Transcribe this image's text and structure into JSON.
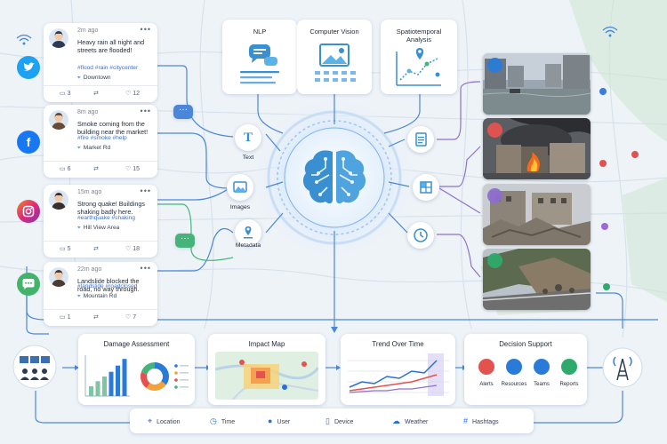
{
  "posts": [
    {
      "time": "2m ago",
      "text": "Heavy rain all night and streets are flooded!",
      "tags": "#flood  #rain  #citycenter",
      "location": "Downtown",
      "replies": "3",
      "likes": "12",
      "avatar_color": "#2b3a55"
    },
    {
      "time": "8m ago",
      "text": "Smoke coming from the building near the market!",
      "tags": "#fire  #smoke  #help",
      "location": "Market Rd",
      "replies": "6",
      "likes": "15",
      "avatar_color": "#6b4a35"
    },
    {
      "time": "15m ago",
      "text": "Strong quake! Buildings shaking badly here.",
      "tags": "#earthquake  #shaking",
      "location": "Hill View Area",
      "replies": "5",
      "likes": "18",
      "avatar_color": "#3a2e2a"
    },
    {
      "time": "22m ago",
      "text": "Landslide blocked the road, no way through.",
      "tags": "#landslide  #roadclosed",
      "location": "Mountain Rd",
      "replies": "1",
      "likes": "7",
      "avatar_color": "#4a3a30"
    }
  ],
  "social_icons": [
    "twitter-icon",
    "facebook-icon",
    "instagram-icon",
    "message-icon"
  ],
  "modules": [
    {
      "label": "NLP"
    },
    {
      "label": "Computer Vision"
    },
    {
      "label": "Spatiotemporal Analysis"
    }
  ],
  "inputs": [
    {
      "label": "Text",
      "icon": "text-icon"
    },
    {
      "label": "Images",
      "icon": "image-icon"
    },
    {
      "label": "Metadata",
      "icon": "metadata-icon"
    }
  ],
  "outputs": [
    {
      "icon": "document-icon"
    },
    {
      "icon": "map-grid-icon"
    },
    {
      "icon": "clock-icon"
    }
  ],
  "photos": [
    {
      "icon": "flood-icon"
    },
    {
      "icon": "fire-icon"
    },
    {
      "icon": "collapsed-house-icon"
    },
    {
      "icon": "landslide-icon"
    }
  ],
  "panels": {
    "damage": {
      "title": "Damage Assessment",
      "bars": [
        0.25,
        0.38,
        0.5,
        0.62,
        0.78,
        0.95
      ],
      "donut": [
        0.35,
        0.25,
        0.2,
        0.2
      ]
    },
    "impact": {
      "title": "Impact Map"
    },
    "trend": {
      "title": "Trend Over Time"
    },
    "decision": {
      "title": "Decision Support",
      "items": [
        {
          "label": "Alerts",
          "icon": "alert-bell-icon",
          "color": "#e4524f"
        },
        {
          "label": "Resources",
          "icon": "truck-icon",
          "color": "#2a7bd8"
        },
        {
          "label": "Teams",
          "icon": "team-icon",
          "color": "#2a7bd8"
        },
        {
          "label": "Reports",
          "icon": "report-icon",
          "color": "#2faa6b"
        }
      ]
    }
  },
  "legend": [
    {
      "label": "Location",
      "icon": "location-pin-icon",
      "glyph": "⌖"
    },
    {
      "label": "Time",
      "icon": "clock-icon",
      "glyph": "◷"
    },
    {
      "label": "User",
      "icon": "user-icon",
      "glyph": "●"
    },
    {
      "label": "Device",
      "icon": "device-icon",
      "glyph": "▯"
    },
    {
      "label": "Weather",
      "icon": "cloud-icon",
      "glyph": "☁"
    },
    {
      "label": "Hashtags",
      "icon": "hashtag-icon",
      "glyph": "#"
    }
  ],
  "colors": {
    "accent": "#2a6fd8",
    "line": "#4a87d8",
    "brain": "#3a8fd0",
    "green_line": "#45b47a",
    "purple_line": "#8e6fd0"
  }
}
